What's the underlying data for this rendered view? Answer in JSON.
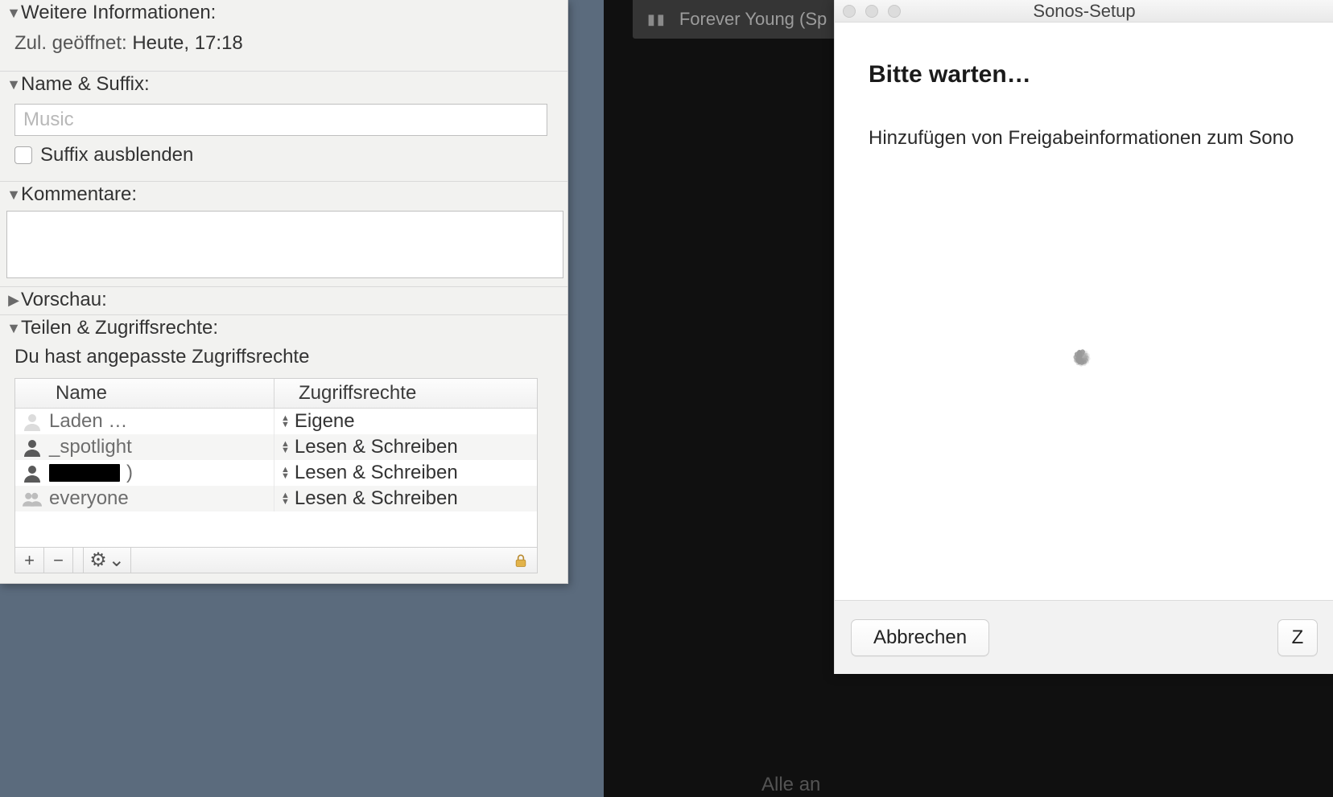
{
  "info": {
    "sections": {
      "more_info": {
        "label": "Weitere Informationen:",
        "expanded": true,
        "last_opened_label": "Zul. geöffnet:",
        "last_opened_value": "Heute, 17:18"
      },
      "name_suffix": {
        "label": "Name & Suffix:",
        "expanded": true,
        "name_value": "Music",
        "hide_suffix_label": "Suffix ausblenden",
        "hide_suffix_checked": false
      },
      "comments": {
        "label": "Kommentare:",
        "expanded": true,
        "value": ""
      },
      "preview": {
        "label": "Vorschau:",
        "expanded": false
      },
      "sharing": {
        "label": "Teilen & Zugriffsrechte:",
        "expanded": true,
        "note": "Du hast angepasste Zugriffsrechte"
      }
    },
    "perm_cols": {
      "name": "Name",
      "priv": "Zugriffsrechte"
    },
    "perm_rows": [
      {
        "icon": "user-light",
        "name": "Laden …",
        "priv": "Eigene"
      },
      {
        "icon": "user-dark",
        "name": "_spotlight",
        "priv": "Lesen & Schreiben"
      },
      {
        "icon": "user-dark",
        "name": "█████",
        "suffix": ")",
        "priv": "Lesen & Schreiben",
        "redacted": true
      },
      {
        "icon": "group",
        "name": "everyone",
        "priv": "Lesen & Schreiben"
      }
    ],
    "toolbar": {
      "add": "+",
      "remove": "−",
      "gear": "⚙",
      "chevron": "⌄"
    }
  },
  "music": {
    "pause": "▮▮",
    "track": "Forever Young (Sp"
  },
  "bg": {
    "alle": "Alle an"
  },
  "sonos": {
    "title": "Sonos-Setup",
    "heading": "Bitte warten…",
    "message": "Hinzufügen von Freigabeinformationen zum Sono",
    "cancel": "Abbrechen",
    "next": "Z"
  }
}
